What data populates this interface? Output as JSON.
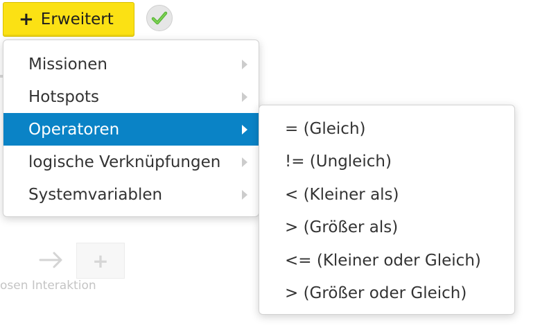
{
  "toolbar": {
    "add_button_icon": "+",
    "add_button_label": "Erweitert",
    "accent_color": "#fbe114",
    "check_icon": "check-icon",
    "check_color": "#5cb83a"
  },
  "background": {
    "plus_symbol": "+",
    "label": "osen Interaktion"
  },
  "menu": {
    "items": [
      {
        "label": "Missionen"
      },
      {
        "label": "Hotspots"
      },
      {
        "label": "Operatoren"
      },
      {
        "label": "logische Verknüpfungen"
      },
      {
        "label": "Systemvariablen"
      }
    ],
    "active_index": 2,
    "active_color": "#0a83c6"
  },
  "submenu": {
    "items": [
      {
        "label": "= (Gleich)"
      },
      {
        "label": "!= (Ungleich)"
      },
      {
        "label": "< (Kleiner als)"
      },
      {
        "label": "> (Größer als)"
      },
      {
        "label": "<= (Kleiner oder Gleich)"
      },
      {
        "label": "> (Größer oder Gleich)"
      }
    ]
  }
}
